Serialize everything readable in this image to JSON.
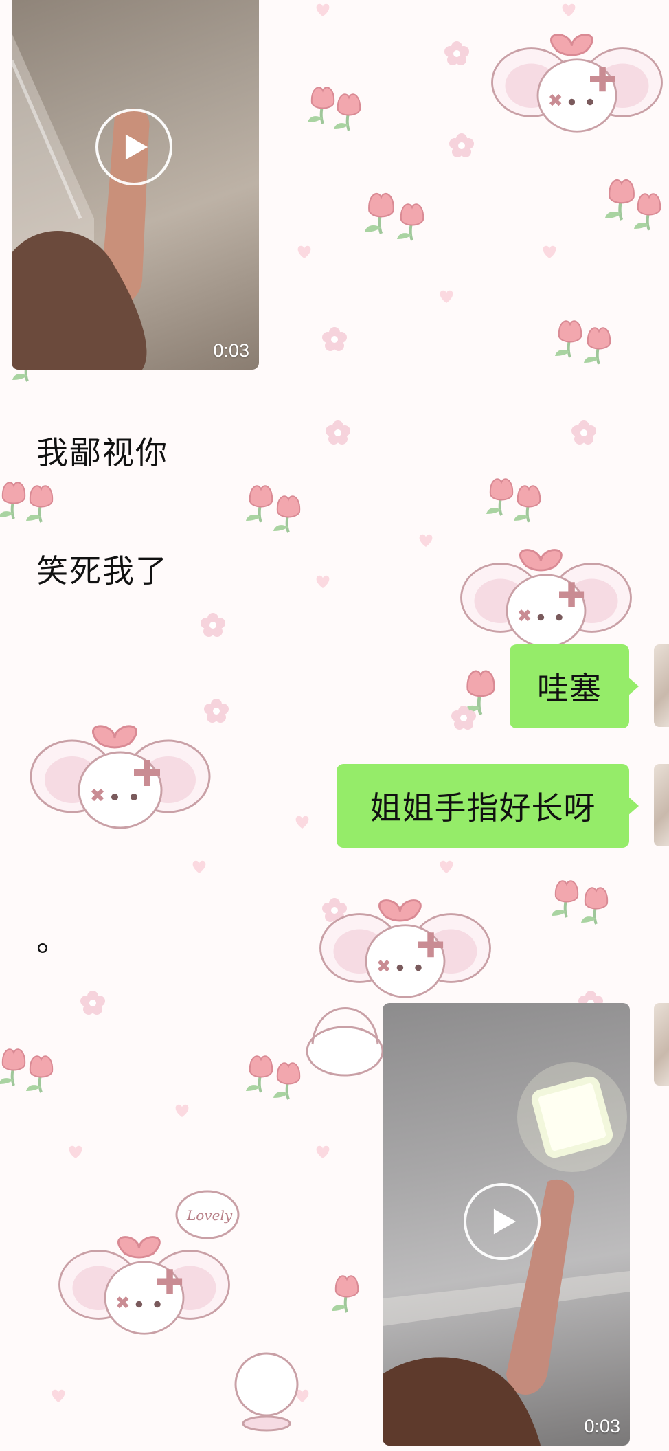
{
  "chat": {
    "video_top": {
      "duration": "0:03"
    },
    "messages_received": [
      {
        "text": "我鄙视你"
      },
      {
        "text": "笑死我了"
      },
      {
        "text": "。"
      }
    ],
    "messages_sent": [
      {
        "text": "哇塞"
      },
      {
        "text": "姐姐手指好长呀"
      }
    ],
    "video_bottom": {
      "duration": "0:03"
    }
  },
  "colors": {
    "sent_bubble": "#95ec69",
    "background": "#fffafa"
  },
  "icons": [
    "play-icon",
    "avatar"
  ]
}
